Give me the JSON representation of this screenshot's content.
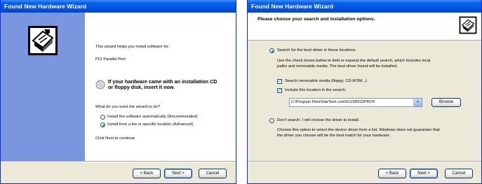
{
  "left_window": {
    "title": "Found New Hardware Wizard",
    "intro": "This wizard helps you install software for:",
    "device_name": "PCI Parallel Port",
    "cd_prompt_line1": "If your hardware came with an installation CD",
    "cd_prompt_line2": "or floppy disk, insert it now.",
    "question": "What do you want the wizard to do?",
    "options": [
      {
        "label": "Install the software automatically (Recommended)",
        "selected": false
      },
      {
        "label": "Install from a list or specific location (Advanced)",
        "selected": true
      }
    ],
    "footer_hint": "Click Next to continue.",
    "buttons": {
      "back": "< Back",
      "next": "Next >",
      "cancel": "Cancel"
    }
  },
  "right_window": {
    "title": "Found New Hardware Wizard",
    "heading": "Please choose your search and installation options.",
    "option_search": "Search for the best driver in these locations.",
    "search_desc_line1": "Use the check boxes below to limit or expand the default search, which includes local",
    "search_desc_line2": "paths and removable media. The best driver found will be installed.",
    "check_removable": "Search removable media (floppy, CD-ROM...)",
    "check_include": "Include this location in the search:",
    "path_value": "C:\\Program Files\\StarTech.com\\ICUSB232PROX",
    "browse": "Browse",
    "option_dont_search": "Don't search. I will choose the driver to install.",
    "dont_desc_line1": "Choose this option to select the device driver from a list.  Windows does not guarantee that",
    "dont_desc_line2": "the driver you choose will be the best match for your hardware.",
    "buttons": {
      "back": "< Back",
      "next": "Next >",
      "cancel": "Cancel"
    }
  },
  "colors": {
    "title_bar": "#0054e3",
    "banner": "#7a96df",
    "dialog_bg": "#ece9d8",
    "radio_dot": "#21a121"
  },
  "icons": [
    "hardware-wizard-icon",
    "cd-icon",
    "chevron-down-icon"
  ]
}
